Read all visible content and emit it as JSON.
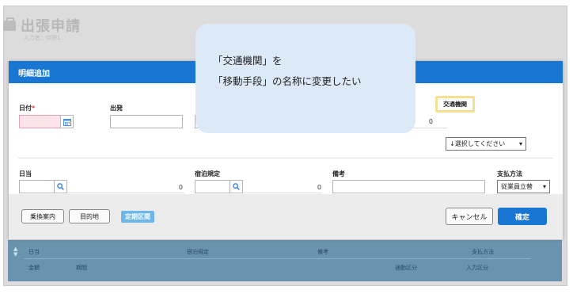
{
  "page": {
    "title": "出張申請",
    "subtitle": "入力者：伴野1"
  },
  "modal": {
    "title": "明細追加",
    "row1": {
      "date_label": "日付",
      "required_mark": "*",
      "departure_label": "出発",
      "amount_value": "0",
      "transport_label": "交通機関",
      "transport_select": "↓選択してください"
    },
    "row2": {
      "allowance_label": "日当",
      "allowance_value": "0",
      "lodging_label": "宿泊規定",
      "lodging_value": "0",
      "notes_label": "備考",
      "payment_label": "支払方法",
      "payment_select": "従業員立替"
    },
    "footer": {
      "transfer_guide": "乗換案内",
      "destination": "目的地",
      "commuter_pass": "定期区間",
      "cancel": "キャンセル",
      "confirm": "確定"
    }
  },
  "callout": {
    "line1": "「交通機関」を",
    "line2": "「移動手段」の名称に変更したい"
  },
  "background_table": {
    "header": [
      "日当",
      "宿泊規定",
      "備考",
      "支払方法"
    ],
    "subheader": [
      "金額",
      "期間",
      "通勤区分",
      "入力区分"
    ]
  }
}
